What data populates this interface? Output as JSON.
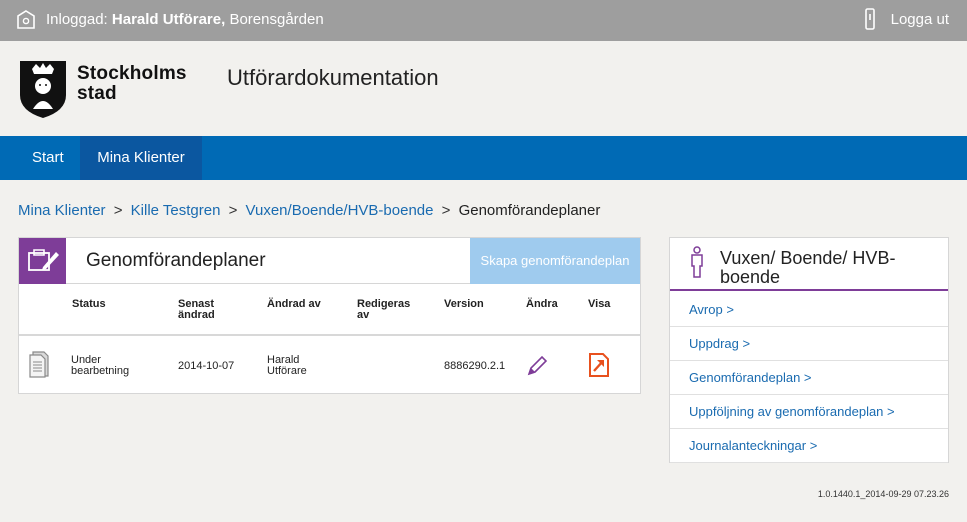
{
  "topbar": {
    "login_prefix": "Inloggad:",
    "user_name": "Harald Utförare,",
    "organisation": "Borensgården",
    "logout_label": "Logga ut"
  },
  "header": {
    "logo_line1": "Stockholms",
    "logo_line2": "stad",
    "app_title": "Utförardokumentation"
  },
  "nav": {
    "items": [
      {
        "label": "Start"
      },
      {
        "label": "Mina Klienter"
      }
    ]
  },
  "breadcrumb": {
    "items": [
      "Mina Klienter",
      "Kille Testgren",
      "Vuxen/Boende/HVB-boende"
    ],
    "current": "Genomförandeplaner",
    "separator": ">"
  },
  "panel": {
    "title": "Genomförandeplaner",
    "create_button": "Skapa genomförandeplan",
    "columns": {
      "status": "Status",
      "changed_line1": "Senast",
      "changed_line2": "ändrad",
      "changed_by": "Ändrad av",
      "editing_line1": "Redigeras",
      "editing_line2": "av",
      "version": "Version",
      "edit": "Ändra",
      "view": "Visa"
    },
    "rows": [
      {
        "status_line1": "Under",
        "status_line2": "bearbetning",
        "changed": "2014-10-07",
        "changed_by_line1": "Harald",
        "changed_by_line2": "Utförare",
        "editing_by": "",
        "version": "8886290.2.1"
      }
    ]
  },
  "side": {
    "title": "Vuxen/ Boende/ HVB-boende",
    "links": [
      "Avrop >",
      "Uppdrag >",
      "Genomförandeplan >",
      "Uppföljning av genomförandeplan >",
      "Journalanteckningar >"
    ]
  },
  "footer": {
    "version": "1.0.1440.1_2014-09-29 07.23.26"
  },
  "colors": {
    "topbar": "#9e9e9e",
    "nav": "#006ab5",
    "nav_active": "#0b57a0",
    "accent_purple": "#7e3d98",
    "link": "#1a6bb0",
    "create_button": "#9fcbee",
    "view_icon": "#e8511e"
  },
  "icons": [
    "home-icon",
    "logout-icon",
    "city-crest-logo",
    "plan-icon",
    "document-icon",
    "pencil-icon",
    "open-icon",
    "person-icon"
  ]
}
